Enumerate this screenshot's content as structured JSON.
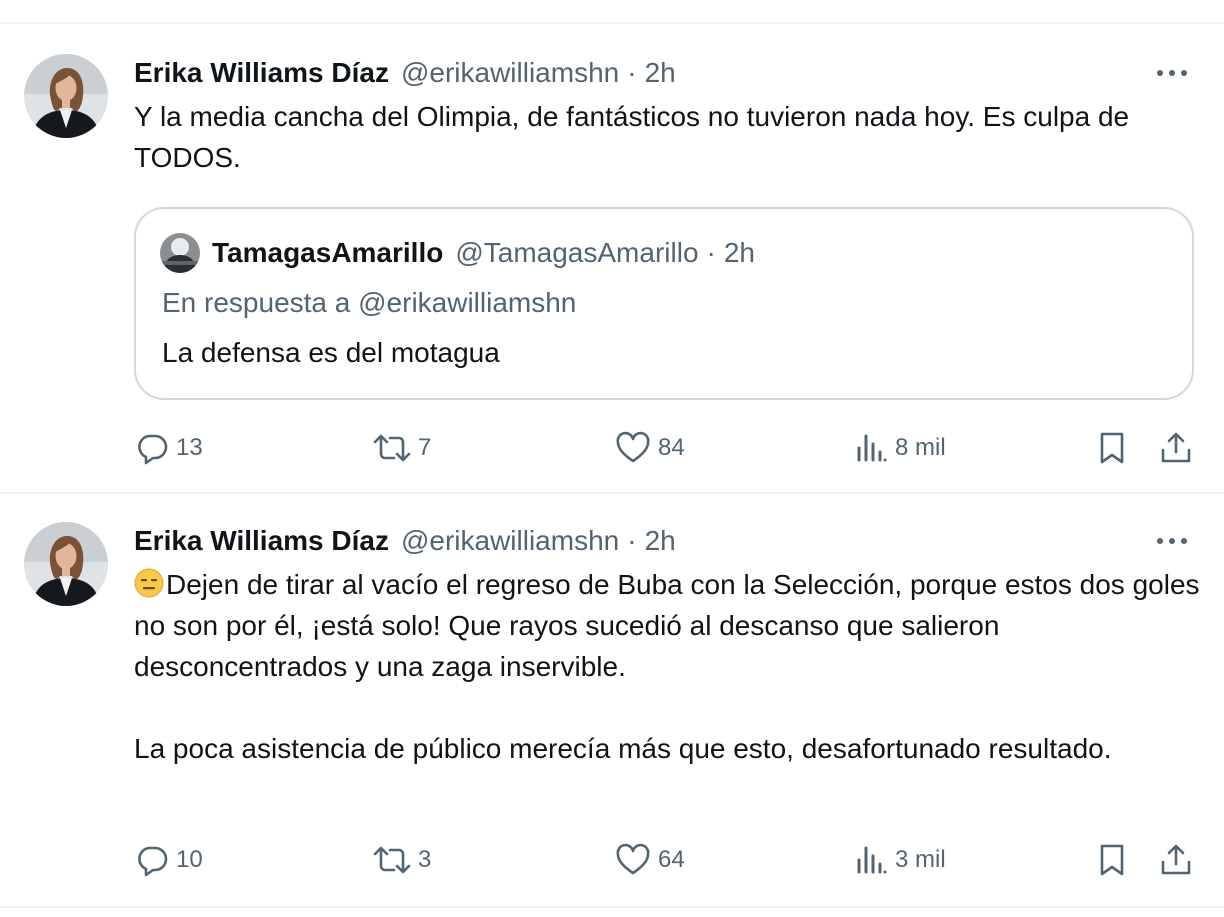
{
  "tweets": [
    {
      "name": "Erika Williams Díaz",
      "handle": "@erikawilliamshn",
      "separator": "·",
      "time": "2h",
      "text": [
        "Y la media cancha del Olimpia, de fantásticos no tuvieron nada hoy. Es culpa de TODOS."
      ],
      "quote": {
        "name": "TamagasAmarillo",
        "handle": "@TamagasAmarillo",
        "separator": "·",
        "time": "2h",
        "reply_to": "En respuesta a @erikawilliamshn",
        "text": "La defensa es del motagua"
      },
      "actions": {
        "replies": "13",
        "retweets": "7",
        "likes": "84",
        "views": "8 mil"
      }
    },
    {
      "name": "Erika Williams Díaz",
      "handle": "@erikawilliamshn",
      "separator": "·",
      "time": "2h",
      "emoji": "expressionless-face",
      "text": [
        "Dejen de tirar al vacío el regreso de Buba con la Selección, porque estos dos goles no son por él, ¡está solo! Que rayos sucedió al descanso que salieron desconcentrados y una zaga inservible.",
        "La poca asistencia de público merecía más que esto, desafortunado resultado."
      ],
      "actions": {
        "replies": "10",
        "retweets": "3",
        "likes": "64",
        "views": "3 mil"
      }
    }
  ],
  "icons": {
    "more": "more-horizontal-icon",
    "reply": "reply-icon",
    "retweet": "retweet-icon",
    "like": "heart-icon",
    "views": "views-bar-icon",
    "bookmark": "bookmark-icon",
    "share": "share-icon"
  },
  "colors": {
    "text": "#0f1419",
    "secondary": "#536471",
    "border": "#cfd9de",
    "divider": "#eff3f4"
  }
}
